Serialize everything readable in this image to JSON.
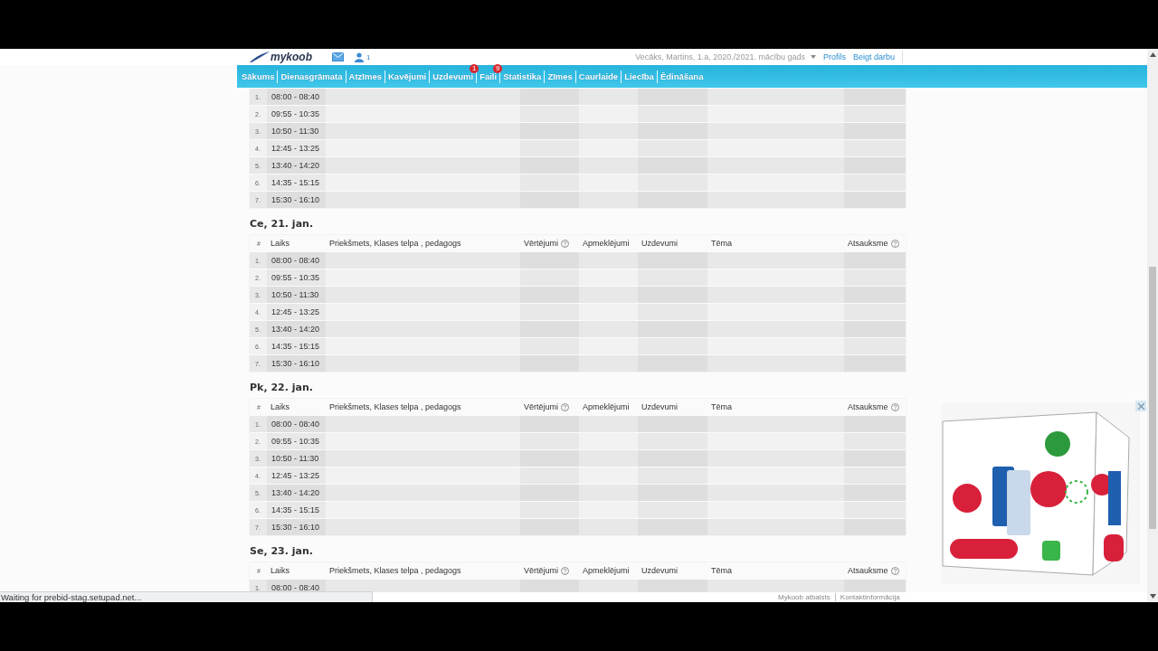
{
  "header": {
    "logo": "mykoob",
    "message_count": "1",
    "user": "Vecāks, Martins, 1.a, 2020./2021. mācību gads",
    "links": [
      "Profils",
      "Beigt darbu"
    ]
  },
  "nav": {
    "tabs": [
      {
        "label": "Sākums"
      },
      {
        "label": "Dienasgrāmata"
      },
      {
        "label": "Atzīmes"
      },
      {
        "label": "Kavējumi"
      },
      {
        "label": "Uzdevumi",
        "badge": "1"
      },
      {
        "label": "Faili",
        "badge": "9"
      },
      {
        "label": "Statistika"
      },
      {
        "label": "Zīmes"
      },
      {
        "label": "Caurlaide"
      },
      {
        "label": "Liecība"
      },
      {
        "label": "Ēdināšana"
      }
    ]
  },
  "days": [
    {
      "rows": [
        {
          "num": "1.",
          "time": "08:00 - 08:40"
        },
        {
          "num": "2.",
          "time": "09:55 - 10:35"
        },
        {
          "num": "3.",
          "time": "10:50 - 11:30"
        },
        {
          "num": "4.",
          "time": "12:45 - 13:25"
        },
        {
          "num": "5.",
          "time": "13:40 - 14:20"
        },
        {
          "num": "6.",
          "time": "14:35 - 15:15"
        },
        {
          "num": "7.",
          "time": "15:30 - 16:10"
        }
      ]
    },
    {
      "title": "Ce, 21. jan.",
      "columns": [
        {
          "label": "#",
          "help": false
        },
        {
          "label": "Laiks",
          "help": false
        },
        {
          "label": "Priekšmets, Klases telpa , pedagogs",
          "help": false
        },
        {
          "label": "Vērtējumi",
          "help": true
        },
        {
          "label": "Apmeklējumi",
          "help": false
        },
        {
          "label": "Uzdevumi",
          "help": false
        },
        {
          "label": "Tēma",
          "help": false
        },
        {
          "label": "Atsauksme",
          "help": true
        }
      ],
      "rows": [
        {
          "num": "1.",
          "time": "08:00 - 08:40"
        },
        {
          "num": "2.",
          "time": "09:55 - 10:35"
        },
        {
          "num": "3.",
          "time": "10:50 - 11:30"
        },
        {
          "num": "4.",
          "time": "12:45 - 13:25"
        },
        {
          "num": "5.",
          "time": "13:40 - 14:20"
        },
        {
          "num": "6.",
          "time": "14:35 - 15:15"
        },
        {
          "num": "7.",
          "time": "15:30 - 16:10"
        }
      ]
    },
    {
      "title": "Pk, 22. jan.",
      "columns": [
        {
          "label": "#",
          "help": false
        },
        {
          "label": "Laiks",
          "help": false
        },
        {
          "label": "Priekšmets, Klases telpa , pedagogs",
          "help": false
        },
        {
          "label": "Vērtējumi",
          "help": true
        },
        {
          "label": "Apmeklējumi",
          "help": false
        },
        {
          "label": "Uzdevumi",
          "help": false
        },
        {
          "label": "Tēma",
          "help": false
        },
        {
          "label": "Atsauksme",
          "help": true
        }
      ],
      "rows": [
        {
          "num": "1.",
          "time": "08:00 - 08:40"
        },
        {
          "num": "2.",
          "time": "09:55 - 10:35"
        },
        {
          "num": "3.",
          "time": "10:50 - 11:30"
        },
        {
          "num": "4.",
          "time": "12:45 - 13:25"
        },
        {
          "num": "5.",
          "time": "13:40 - 14:20"
        },
        {
          "num": "6.",
          "time": "14:35 - 15:15"
        },
        {
          "num": "7.",
          "time": "15:30 - 16:10"
        }
      ]
    },
    {
      "title": "Se, 23. jan.",
      "columns": [
        {
          "label": "#",
          "help": false
        },
        {
          "label": "Laiks",
          "help": false
        },
        {
          "label": "Priekšmets, Klases telpa , pedagogs",
          "help": false
        },
        {
          "label": "Vērtējumi",
          "help": true
        },
        {
          "label": "Apmeklējumi",
          "help": false
        },
        {
          "label": "Uzdevumi",
          "help": false
        },
        {
          "label": "Tēma",
          "help": false
        },
        {
          "label": "Atsauksme",
          "help": true
        }
      ],
      "rows": [
        {
          "num": "1.",
          "time": "08:00 - 08:40"
        }
      ]
    }
  ],
  "footer": {
    "links": [
      "Mykoob atbalsts",
      "Kontaktinformācija"
    ]
  },
  "status": "Waiting for prebid-stag.setupad.net..."
}
